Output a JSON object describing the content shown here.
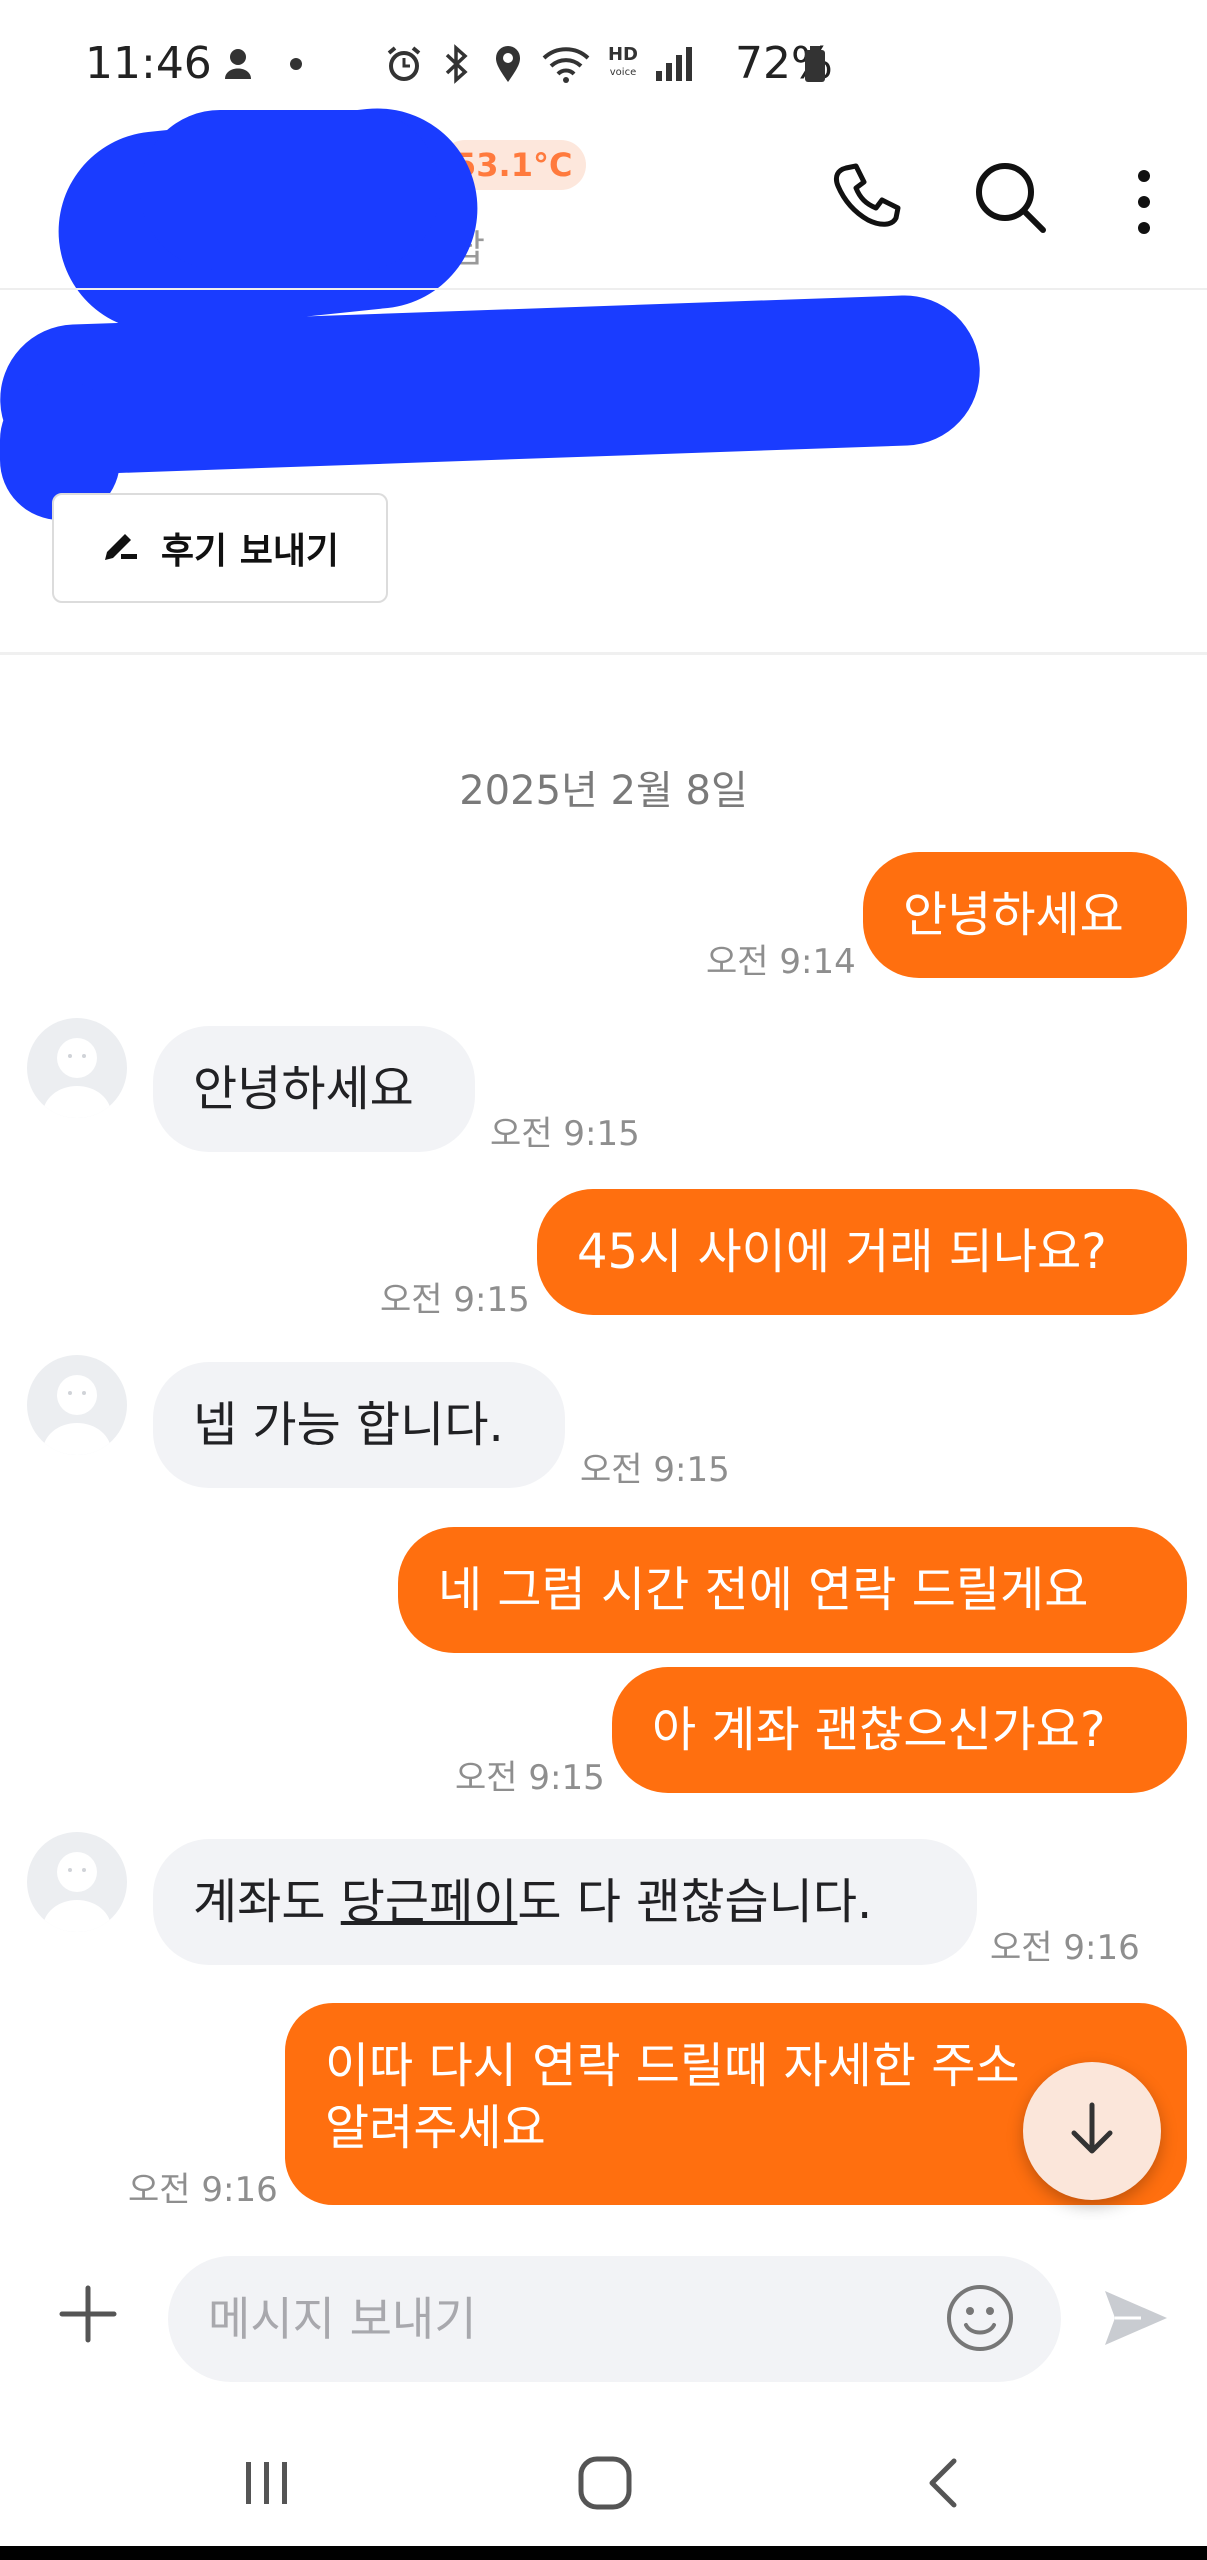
{
  "status_bar": {
    "time": "11:46",
    "battery": "72%",
    "network_label": "HD"
  },
  "header": {
    "temperature": "53.1°C",
    "subtitle": "답",
    "icons": [
      "phone-icon",
      "search-icon",
      "more-vert-icon"
    ]
  },
  "review": {
    "button_label": "후기 보내기",
    "icon": "pencil-icon"
  },
  "chat": {
    "date": "2025년 2월 8일",
    "messages": [
      {
        "dir": "out",
        "text": "안녕하세요",
        "time": "오전 9:14"
      },
      {
        "dir": "in",
        "text": "안녕하세요",
        "time": "오전 9:15"
      },
      {
        "dir": "out",
        "text": "45시 사이에 거래 되나요?",
        "time": "오전 9:15"
      },
      {
        "dir": "in",
        "text": "넵 가능 합니다.",
        "time": "오전 9:15"
      },
      {
        "dir": "out",
        "text": "네 그럼 시간 전에 연락 드릴게요",
        "time": ""
      },
      {
        "dir": "out",
        "text": "아 계좌 괜찮으신가요?",
        "time": "오전 9:15"
      },
      {
        "dir": "in",
        "text_before": "계좌도 ",
        "link": "당근페이",
        "text_after": "도 다 괜찮습니다.",
        "time": "오전 9:16"
      },
      {
        "dir": "out",
        "line1": "이따 다시 연락 드릴때 자세한 주소",
        "line2": "알려주세요",
        "time": "오전 9:16"
      }
    ]
  },
  "composer": {
    "placeholder": "메시지 보내기",
    "value": ""
  },
  "colors": {
    "accent": "#ff6f0f",
    "incoming_bubble": "#f2f3f6",
    "redaction": "#1a3cff"
  }
}
